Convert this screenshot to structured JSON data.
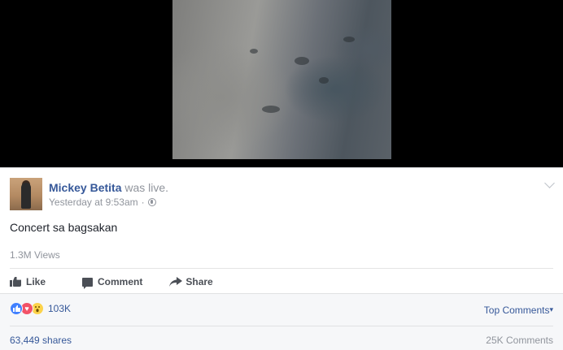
{
  "post": {
    "author": "Mickey Betita",
    "status": "was live.",
    "timestamp": "Yesterday at 9:53am",
    "separator": "·",
    "caption": "Concert sa bagsakan",
    "views": "1.3M Views"
  },
  "actions": {
    "like": "Like",
    "comment": "Comment",
    "share": "Share"
  },
  "reactions": {
    "count": "103K",
    "wow_glyph": "😮",
    "love_glyph": "♥",
    "like_glyph": "👍",
    "colors": {
      "like": "#4080ff",
      "love": "#f25268",
      "wow": "#fcd34b"
    }
  },
  "footer": {
    "top_comments": "Top Comments",
    "dropdown_glyph": "▾",
    "shares": "63,449 shares",
    "comments": "25K Comments"
  },
  "colors": {
    "link": "#365899",
    "muted": "#90949c"
  }
}
